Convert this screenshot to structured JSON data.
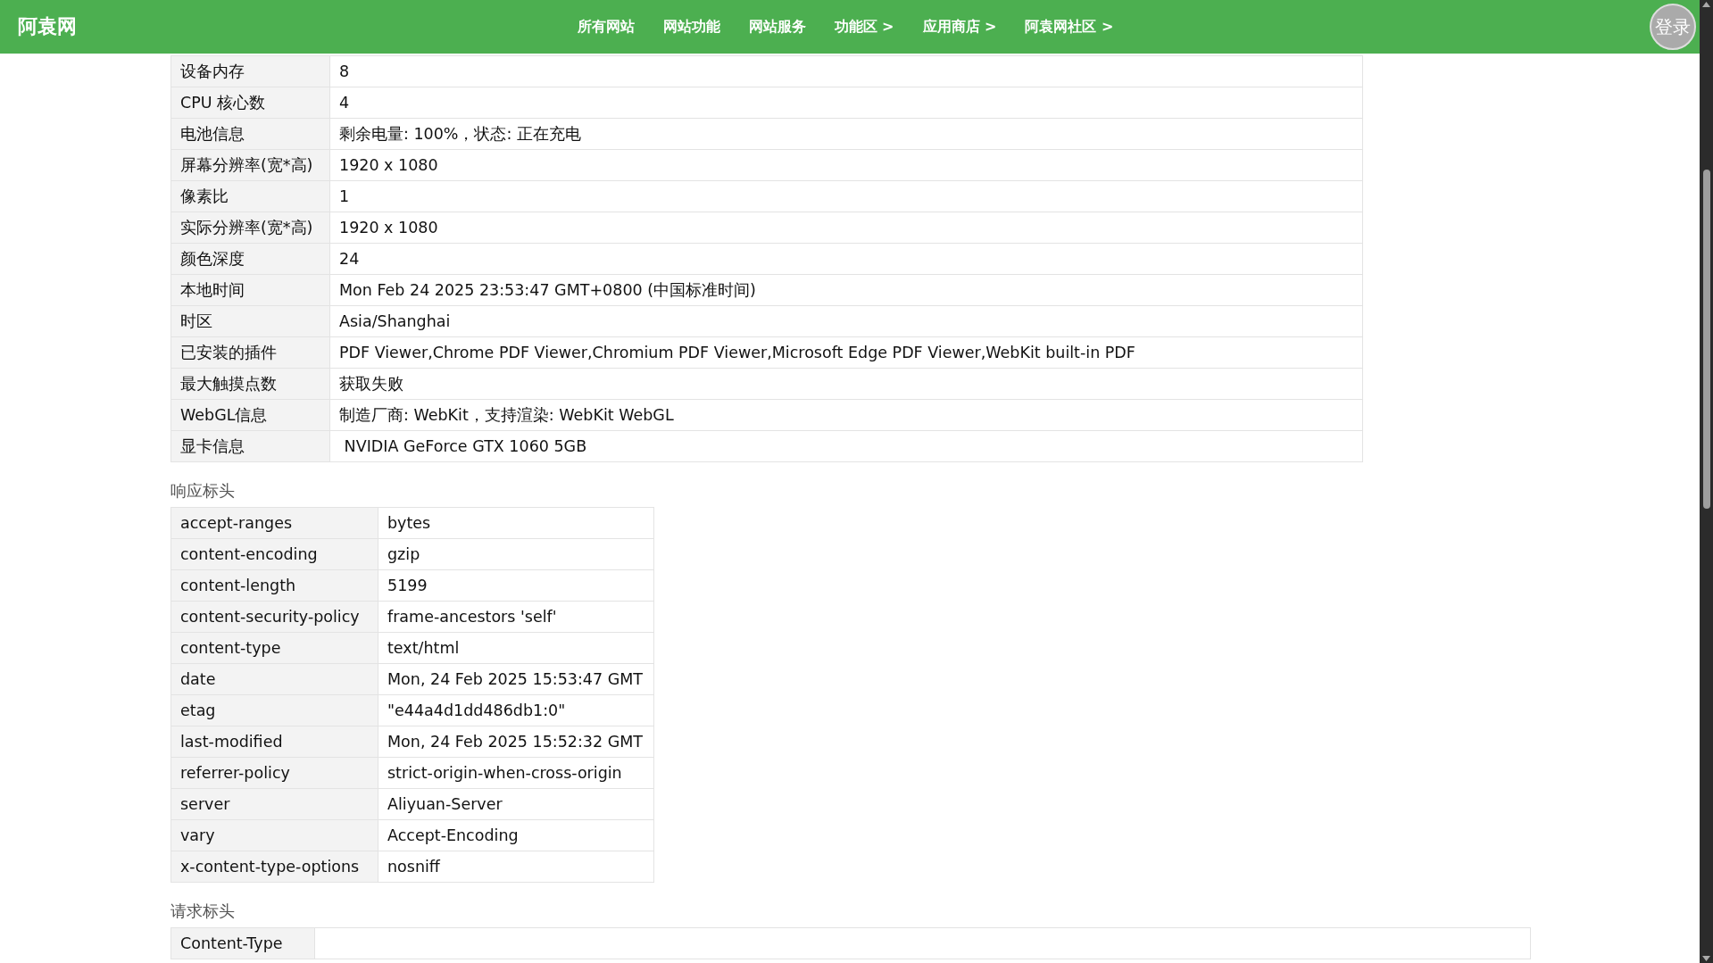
{
  "header": {
    "logo": "阿袁网",
    "nav": [
      {
        "label": "所有网站"
      },
      {
        "label": "网站功能"
      },
      {
        "label": "网站服务"
      },
      {
        "label": "功能区 >"
      },
      {
        "label": "应用商店 >"
      },
      {
        "label": "阿袁网社区 >"
      }
    ],
    "login": "登录"
  },
  "sections": [
    {
      "rows": [
        {
          "key": "设备内存",
          "value": "8"
        },
        {
          "key": "CPU 核心数",
          "value": "4"
        },
        {
          "key": "电池信息",
          "value": "剩余电量: 100%，状态: 正在充电"
        },
        {
          "key": "屏幕分辨率(宽*高)",
          "value": "1920 x 1080"
        },
        {
          "key": "像素比",
          "value": "1"
        },
        {
          "key": "实际分辨率(宽*高)",
          "value": "1920 x 1080"
        },
        {
          "key": "颜色深度",
          "value": "24"
        },
        {
          "key": "本地时间",
          "value": "Mon Feb 24 2025 23:53:47 GMT+0800 (中国标准时间)"
        },
        {
          "key": "时区",
          "value": "Asia/Shanghai"
        },
        {
          "key": "已安装的插件",
          "value": "PDF Viewer,Chrome PDF Viewer,Chromium PDF Viewer,Microsoft Edge PDF Viewer,WebKit built-in PDF"
        },
        {
          "key": "最大触摸点数",
          "value": "获取失败"
        },
        {
          "key": "WebGL信息",
          "value": "制造厂商: WebKit，支持渲染: WebKit WebGL"
        },
        {
          "key": "显卡信息",
          "value": " NVIDIA GeForce GTX 1060 5GB"
        }
      ]
    },
    {
      "title": "响应标头",
      "rows": [
        {
          "key": "accept-ranges",
          "value": "bytes"
        },
        {
          "key": "content-encoding",
          "value": "gzip"
        },
        {
          "key": "content-length",
          "value": "5199"
        },
        {
          "key": "content-security-policy",
          "value": "frame-ancestors 'self'"
        },
        {
          "key": "content-type",
          "value": "text/html"
        },
        {
          "key": "date",
          "value": "Mon, 24 Feb 2025 15:53:47 GMT"
        },
        {
          "key": "etag",
          "value": "\"e44a4d1dd486db1:0\""
        },
        {
          "key": "last-modified",
          "value": "Mon, 24 Feb 2025 15:52:32 GMT"
        },
        {
          "key": "referrer-policy",
          "value": "strict-origin-when-cross-origin"
        },
        {
          "key": "server",
          "value": "Aliyuan-Server"
        },
        {
          "key": "vary",
          "value": "Accept-Encoding"
        },
        {
          "key": "x-content-type-options",
          "value": "nosniff"
        }
      ]
    },
    {
      "title": "请求标头",
      "rows": [
        {
          "key": "Content-Type"
        }
      ]
    }
  ]
}
